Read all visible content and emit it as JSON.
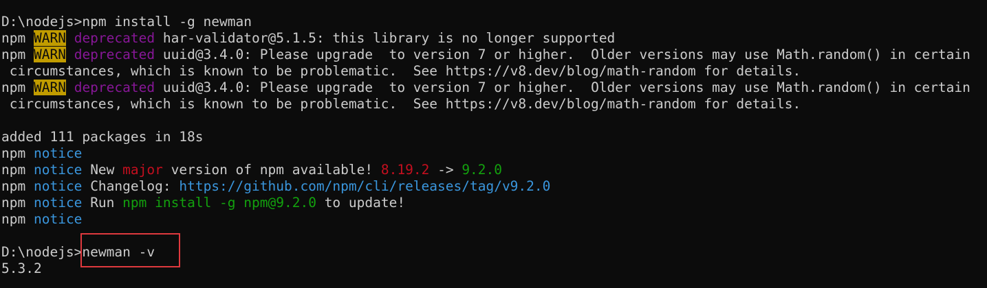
{
  "terminal": {
    "install_prompt": "D:\\nodejs>",
    "install_command": "npm install -g newman",
    "warn_prefix": "npm",
    "warn_tag": "WARN",
    "deprecated_tag": "deprecated",
    "warn1_text": "har-validator@5.1.5: this library is no longer supported",
    "warn2_text": "uuid@3.4.0: Please upgrade  to version 7 or higher.  Older versions may use Math.random() in certain",
    "warn2_cont": " circumstances, which is known to be problematic.  See https://v8.dev/blog/math-random for details.",
    "warn3_text": "uuid@3.4.0: Please upgrade  to version 7 or higher.  Older versions may use Math.random() in certain",
    "warn3_cont": " circumstances, which is known to be problematic.  See https://v8.dev/blog/math-random for details.",
    "added_line": "added 111 packages in 18s",
    "notice_prefix": "npm",
    "notice_tag": "notice",
    "notice_new": "New",
    "notice_major": "major",
    "notice_version_text": "version of npm available!",
    "notice_old_version": "8.19.2",
    "notice_arrow": "->",
    "notice_new_version": "9.2.0",
    "notice_changelog_label": "Changelog:",
    "notice_changelog_url": "https://github.com/npm/cli/releases/tag/v9.2.0",
    "notice_run": "Run",
    "notice_run_command": "npm install -g npm@9.2.0",
    "notice_run_suffix": "to update!",
    "version_prompt": "D:\\nodejs>",
    "version_command": "newman -v",
    "version_output": "5.3.2"
  }
}
